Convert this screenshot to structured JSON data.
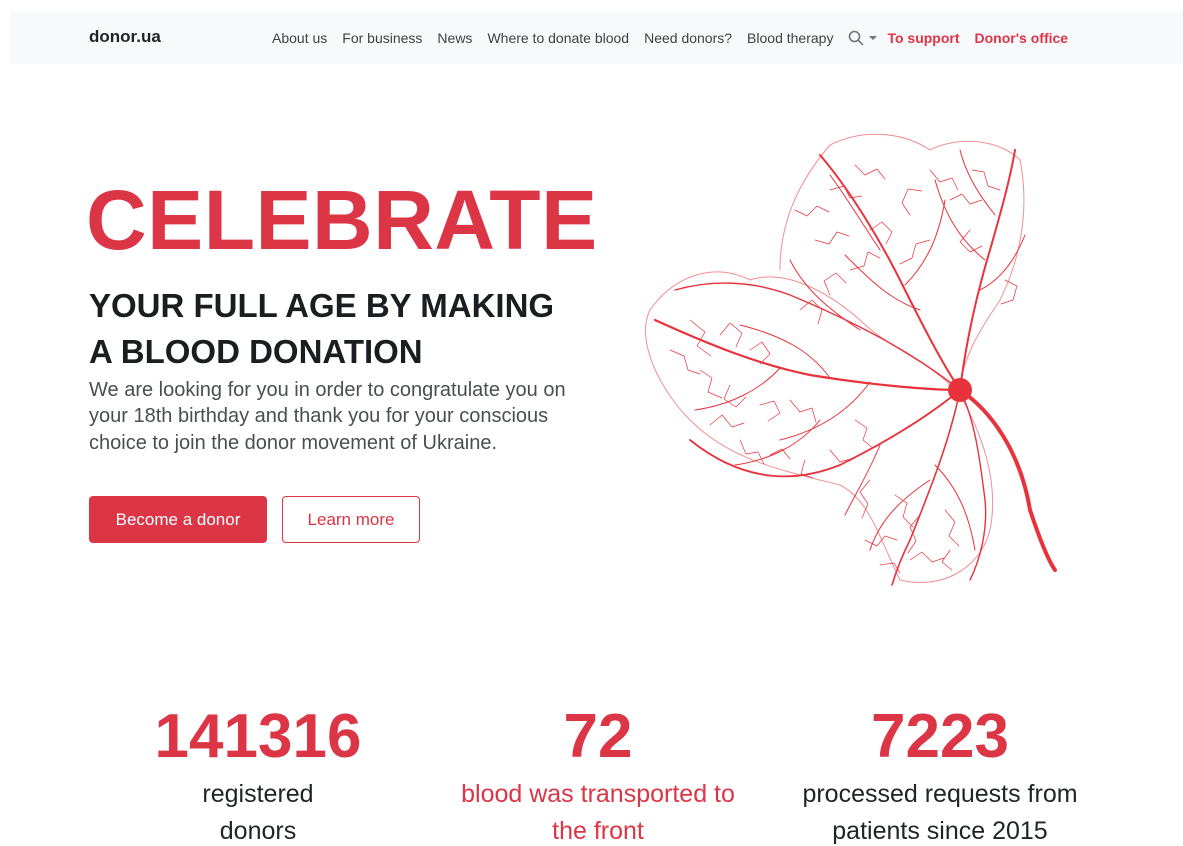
{
  "header": {
    "brand": "donor.ua",
    "nav": [
      "About us",
      "For business",
      "News",
      "Where to donate blood",
      "Need donors?",
      "Blood therapy"
    ],
    "search_icon": "search-icon",
    "support_label": "To support",
    "office_label": "Donor's office"
  },
  "hero": {
    "title": "CELEBRATE",
    "subtitle_line1": "YOUR FULL AGE BY MAKING",
    "subtitle_line2": "A BLOOD DONATION",
    "text": "We are looking for you in order to congratulate you on your 18th birthday and thank you for your conscious choice to join the donor movement of Ukraine.",
    "primary_button": "Become a donor",
    "secondary_button": "Learn more",
    "image_icon": "blood-vessel-leaf-illustration"
  },
  "stats": [
    {
      "value": "141316",
      "label_line1": "registered",
      "label_line2": "donors"
    },
    {
      "value": "72",
      "label_line1": "blood was transported to",
      "label_line2": "the front"
    },
    {
      "value": "7223",
      "label_line1": "processed requests from",
      "label_line2": "patients since 2015"
    }
  ],
  "colors": {
    "accent": "#dc3545",
    "nav_bg": "#f8f9fa",
    "text_dark": "#212529"
  }
}
